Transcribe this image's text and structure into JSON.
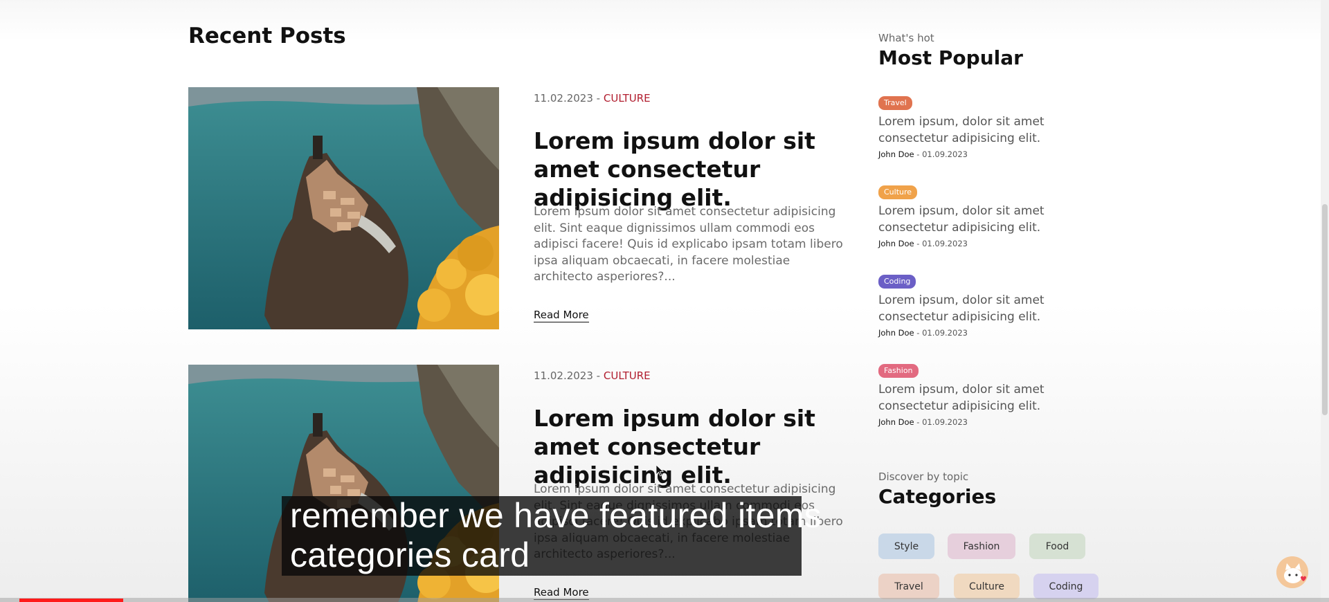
{
  "recent_posts": {
    "title": "Recent Posts",
    "posts": [
      {
        "image": "cliffside-village-photo",
        "date": "11.02.2023",
        "separator": "-",
        "category": "CULTURE",
        "title": "Lorem ipsum dolor sit amet consectetur adipisicing elit.",
        "description": "Lorem ipsum dolor sit amet consectetur adipisicing elit. Sint eaque dignissimos ullam commodi eos adipisci facere! Quis id explicabo ipsam totam libero ipsa aliquam obcaecati, in facere molestiae architecto asperiores?...",
        "read_more": "Read More"
      },
      {
        "image": "cliffside-village-photo",
        "date": "11.02.2023",
        "separator": "-",
        "category": "CULTURE",
        "title": "Lorem ipsum dolor sit amet consectetur adipisicing elit.",
        "description": "Lorem ipsum dolor sit amet consectetur adipisicing elit. Sint eaque dignissimos ullam commodi eos adipisci facere! Quis id explicabo ipsam totam libero ipsa aliquam obcaecati, in facere molestiae architecto asperiores?...",
        "read_more": "Read More"
      }
    ]
  },
  "sidebar": {
    "popular": {
      "eyebrow": "What's hot",
      "title": "Most Popular",
      "items": [
        {
          "tag": "Travel",
          "tag_color": "#e0734f",
          "title": "Lorem ipsum, dolor sit amet consectetur adipisicing elit.",
          "author": "John Doe",
          "date": "01.09.2023"
        },
        {
          "tag": "Culture",
          "tag_color": "#f0a24a",
          "title": "Lorem ipsum, dolor sit amet consectetur adipisicing elit.",
          "author": "John Doe",
          "date": "01.09.2023"
        },
        {
          "tag": "Coding",
          "tag_color": "#6b5fc6",
          "title": "Lorem ipsum, dolor sit amet consectetur adipisicing elit.",
          "author": "John Doe",
          "date": "01.09.2023"
        },
        {
          "tag": "Fashion",
          "tag_color": "#e26a80",
          "title": "Lorem ipsum, dolor sit amet consectetur adipisicing elit.",
          "author": "John Doe",
          "date": "01.09.2023"
        }
      ]
    },
    "categories": {
      "eyebrow": "Discover by topic",
      "title": "Categories",
      "items": [
        {
          "label": "Style",
          "bg": "#c9d8e8"
        },
        {
          "label": "Fashion",
          "bg": "#e6cfdc"
        },
        {
          "label": "Food",
          "bg": "#d6e1d3"
        },
        {
          "label": "Travel",
          "bg": "#ecd2c6"
        },
        {
          "label": "Culture",
          "bg": "#f0d9c0"
        },
        {
          "label": "Coding",
          "bg": "#d6d2ef"
        }
      ]
    }
  },
  "caption": {
    "line1": "remember we have featured items",
    "line2": "categories card"
  },
  "player": {
    "progress": 0.078
  }
}
